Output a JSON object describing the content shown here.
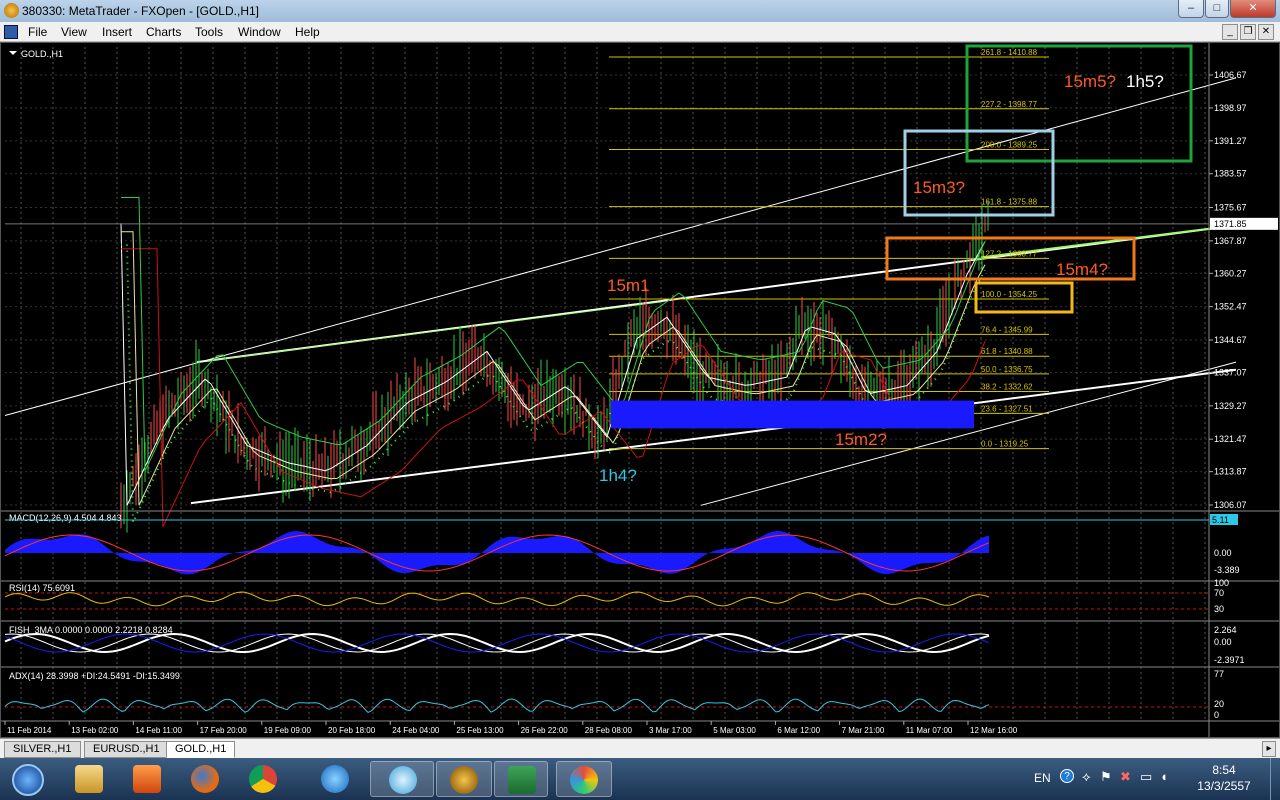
{
  "window": {
    "title": "380330: MetaTrader - FXOpen - [GOLD.,H1]",
    "minimize": "–",
    "maximize": "□",
    "close": "✕"
  },
  "menu": [
    "File",
    "View",
    "Insert",
    "Charts",
    "Tools",
    "Window",
    "Help"
  ],
  "chart": {
    "label": "GOLD.,H1",
    "price_ticks": [
      {
        "label": "1406.67",
        "v": 1406.67
      },
      {
        "label": "1398.97",
        "v": 1398.97
      },
      {
        "label": "1391.27",
        "v": 1391.27
      },
      {
        "label": "1383.57",
        "v": 1383.57
      },
      {
        "label": "1375.67",
        "v": 1375.67
      },
      {
        "label": "1367.87",
        "v": 1367.87
      },
      {
        "label": "1360.27",
        "v": 1360.27
      },
      {
        "label": "1352.47",
        "v": 1352.47
      },
      {
        "label": "1344.67",
        "v": 1344.67
      },
      {
        "label": "1337.07",
        "v": 1337.07
      },
      {
        "label": "1329.27",
        "v": 1329.27
      },
      {
        "label": "1321.47",
        "v": 1321.47
      },
      {
        "label": "1313.87",
        "v": 1313.87
      },
      {
        "label": "1306.07",
        "v": 1306.07
      }
    ],
    "current_price": {
      "label": "1371.85",
      "v": 1371.85
    },
    "fib_levels": [
      {
        "label": "261.8 - 1410.88",
        "v": 1410.88
      },
      {
        "label": "227.2 - 1398.77",
        "v": 1398.77
      },
      {
        "label": "200.0 - 1389.25",
        "v": 1389.25
      },
      {
        "label": "161.8 - 1375.88",
        "v": 1375.88
      },
      {
        "label": "127.2 - 1363.77",
        "v": 1363.77
      },
      {
        "label": "100.0 - 1354.25",
        "v": 1354.25
      },
      {
        "label": "76.4 - 1345.99",
        "v": 1345.99
      },
      {
        "label": "61.8 - 1340.88",
        "v": 1340.88
      },
      {
        "label": "50.0 - 1336.75",
        "v": 1336.75
      },
      {
        "label": "38.2 - 1332.62",
        "v": 1332.62
      },
      {
        "label": "23.6 - 1327.51",
        "v": 1327.51
      },
      {
        "label": "0.0 - 1319.25",
        "v": 1319.25
      }
    ],
    "annotations": [
      {
        "text": "15m1",
        "color": "#ff5a1f"
      },
      {
        "text": "15m2?",
        "color": "#ff5a1f"
      },
      {
        "text": "15m3?",
        "color": "#ff5a1f"
      },
      {
        "text": "15m4?",
        "color": "#ff5a1f"
      },
      {
        "text": "15m5?",
        "color": "#ff5a1f"
      },
      {
        "text": "1h5?",
        "color": "#ffffff"
      },
      {
        "text": "1h4?",
        "color": "#2ec7e6"
      }
    ],
    "time_labels": [
      "11 Feb 2014",
      "13 Feb 02:00",
      "14 Feb 11:00",
      "17 Feb 20:00",
      "19 Feb 09:00",
      "20 Feb 18:00",
      "24 Feb 04:00",
      "25 Feb 13:00",
      "26 Feb 22:00",
      "28 Feb 08:00",
      "3 Mar 17:00",
      "5 Mar 03:00",
      "6 Mar 12:00",
      "7 Mar 21:00",
      "11 Mar 07:00",
      "12 Mar 16:00"
    ]
  },
  "indicators": {
    "macd": {
      "label": "MACD(12,26,9) 4.504 4.843",
      "value_badge": "5.11",
      "zero": "0.00",
      "low": "-3.389"
    },
    "rsi": {
      "label": "RSI(14) 75.6091",
      "top": "100",
      "upper": "70",
      "lower": "30"
    },
    "fish": {
      "label": "FISH_3MA 0.0000 0.0000 2.2218 0.8284",
      "top": "2.264",
      "zero": "0.00",
      "low": "-2.3971"
    },
    "adx": {
      "label": "ADX(14) 28.3998 +DI:24.5491 -DI:15.3499",
      "top": "77",
      "mid": "20",
      "bottom": "0"
    }
  },
  "tabs": [
    "SILVER.,H1",
    "EURUSD.,H1",
    "GOLD.,H1"
  ],
  "tray": {
    "lang": "EN",
    "time": "8:54",
    "date": "13/3/2557"
  },
  "colors": {
    "fib": "#d4c400",
    "box_green": "#1ea53a",
    "box_lightblue": "#9fd0e8",
    "box_orange": "#f07a1c",
    "box_yellow": "#f2b81c",
    "zone_blue": "#1a1aff"
  }
}
